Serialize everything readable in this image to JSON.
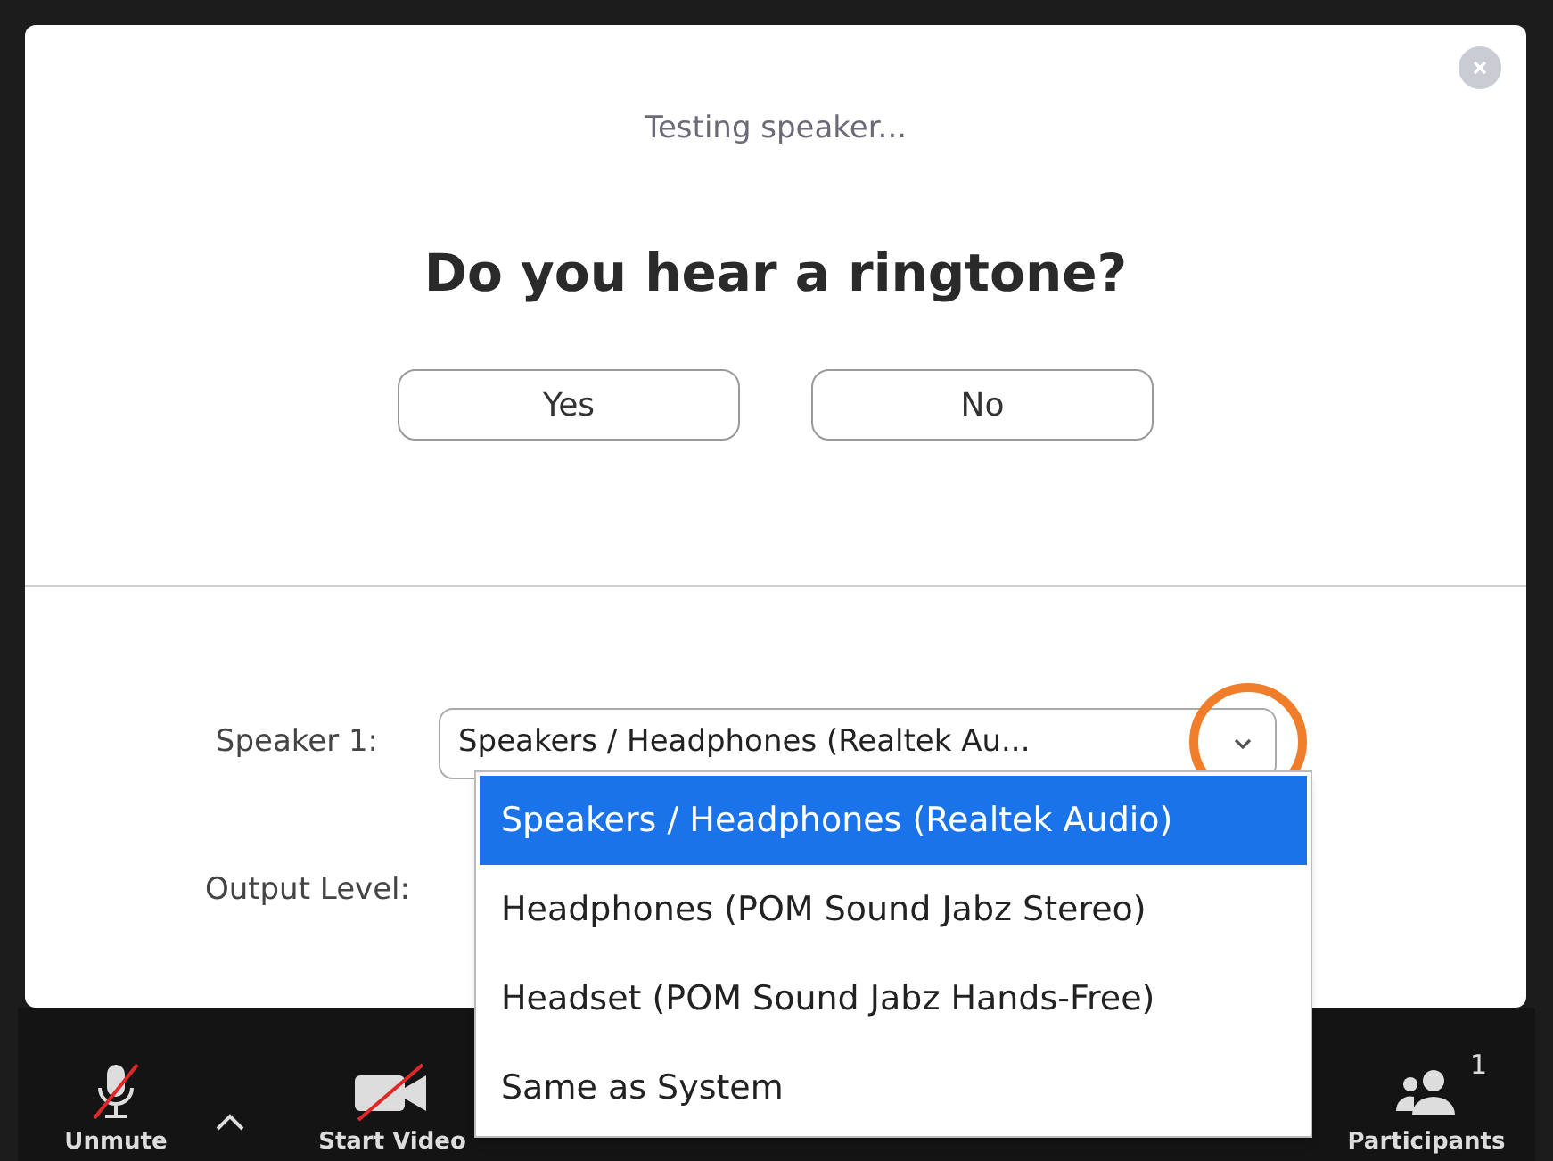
{
  "dialog": {
    "status": "Testing speaker...",
    "question": "Do you hear a ringtone?",
    "buttons": [
      "Yes",
      "No"
    ]
  },
  "speaker": {
    "label": "Speaker 1:",
    "value": "Speakers / Headphones (Realtek Au...",
    "open": true,
    "highlighted": true,
    "options": [
      {
        "label": "Speakers / Headphones (Realtek Audio)",
        "selected": true
      },
      {
        "label": "Headphones (POM Sound Jabz Stereo)",
        "selected": false
      },
      {
        "label": "Headset (POM Sound Jabz Hands-Free)",
        "selected": false
      },
      {
        "label": "Same as System",
        "selected": false
      }
    ]
  },
  "output_level": {
    "label": "Output Level:"
  },
  "toolbar": [
    {
      "kind": "mic",
      "label": "Unmute"
    },
    {
      "kind": "caret"
    },
    {
      "kind": "video",
      "label": "Start Video"
    },
    {
      "kind": "participants",
      "label": "Participants",
      "count": "1"
    }
  ]
}
